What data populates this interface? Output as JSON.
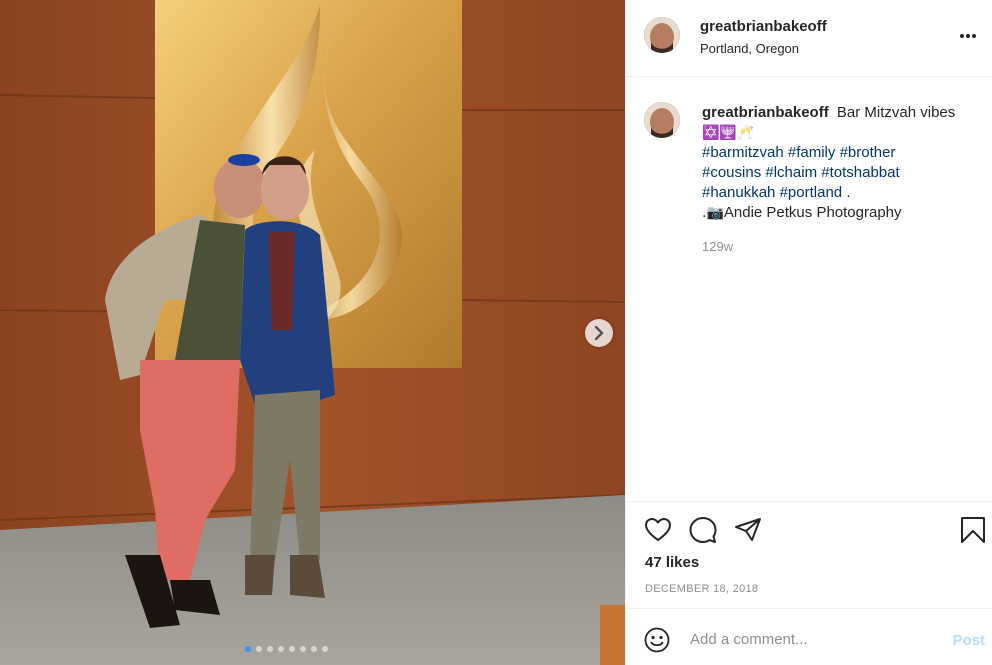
{
  "post": {
    "username": "greatbrianbakeoff",
    "location": "Portland, Oregon",
    "caption": {
      "text": "Bar Mitzvah vibes",
      "emojis": "✡️🕎🥂",
      "hashtags": [
        "#barmitzvah",
        "#family",
        "#brother",
        "#cousins",
        "#lchaim",
        "#totshabbat",
        "#hanukkah",
        "#portland"
      ],
      "trailing": ".",
      "credit_prefix": ".📷",
      "credit": "Andie Petkus Photography"
    },
    "time_ago": "129w",
    "likes": "47 likes",
    "date": "DECEMBER 18, 2018"
  },
  "comment_box": {
    "placeholder": "Add a comment...",
    "post_label": "Post"
  },
  "carousel": {
    "total_slides": 8,
    "current_slide": 1
  },
  "icons": {
    "more": "more-options-icon",
    "like": "heart-icon",
    "comment": "comment-bubble-icon",
    "share": "paper-plane-icon",
    "save": "bookmark-icon",
    "emoji": "smiley-face-icon",
    "next": "chevron-right-icon"
  },
  "colors": {
    "hashtag": "#00376b",
    "post_button_disabled": "#b2dffc",
    "active_dot": "#3897f0",
    "muted_text": "#8e8e8e"
  }
}
